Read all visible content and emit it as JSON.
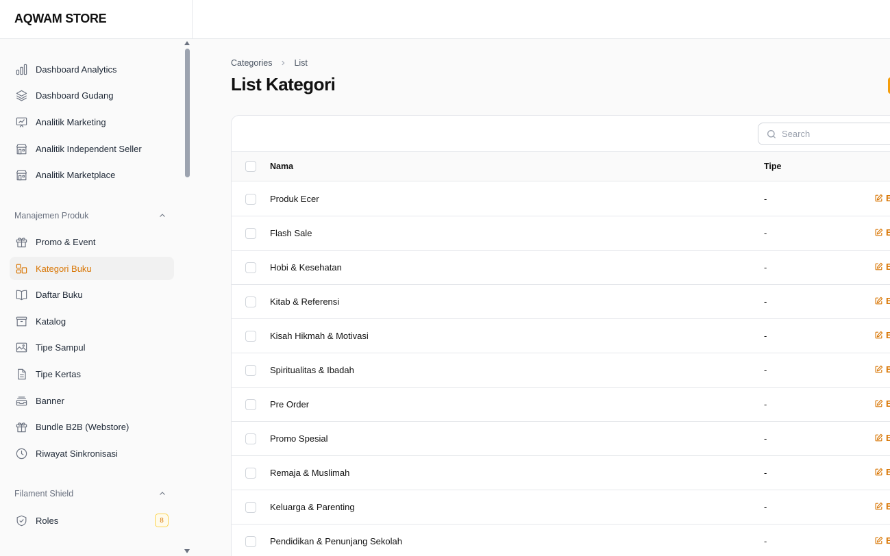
{
  "app": {
    "brand": "AQWAM STORE"
  },
  "colors": {
    "accent": "#d97706",
    "text": "#111827",
    "muted": "#6b7280",
    "border": "#e5e7eb"
  },
  "sidebar": {
    "analytics": [
      {
        "label": "Dashboard Analytics",
        "icon": "bar-chart-icon"
      },
      {
        "label": "Dashboard Gudang",
        "icon": "layers-icon"
      },
      {
        "label": "Analitik Marketing",
        "icon": "presentation-chart-icon"
      },
      {
        "label": "Analitik Independent Seller",
        "icon": "storefront-icon"
      },
      {
        "label": "Analitik Marketplace",
        "icon": "storefront-icon"
      }
    ],
    "groups": [
      {
        "label": "Manajemen Produk",
        "items": [
          {
            "label": "Promo & Event",
            "icon": "gift-icon"
          },
          {
            "label": "Kategori Buku",
            "icon": "grid-icon",
            "active": true
          },
          {
            "label": "Daftar Buku",
            "icon": "book-open-icon"
          },
          {
            "label": "Katalog",
            "icon": "archive-box-icon"
          },
          {
            "label": "Tipe Sampul",
            "icon": "photo-icon"
          },
          {
            "label": "Tipe Kertas",
            "icon": "document-icon"
          },
          {
            "label": "Banner",
            "icon": "inbox-stack-icon"
          },
          {
            "label": "Bundle B2B (Webstore)",
            "icon": "gift-icon"
          },
          {
            "label": "Riwayat Sinkronisasi",
            "icon": "clock-icon"
          }
        ]
      },
      {
        "label": "Filament Shield",
        "items": [
          {
            "label": "Roles",
            "icon": "shield-check-icon",
            "badge": "8"
          }
        ]
      }
    ]
  },
  "main": {
    "breadcrumb": [
      "Categories",
      "List"
    ],
    "title": "List Kategori",
    "search": {
      "placeholder": "Search",
      "value": ""
    },
    "table": {
      "columns": {
        "name": "Nama",
        "type": "Tipe"
      },
      "edit_label": "E",
      "rows": [
        {
          "name": "Produk Ecer",
          "type": "-"
        },
        {
          "name": "Flash Sale",
          "type": "-"
        },
        {
          "name": "Hobi & Kesehatan",
          "type": "-"
        },
        {
          "name": "Kitab & Referensi",
          "type": "-"
        },
        {
          "name": "Kisah Hikmah & Motivasi",
          "type": "-"
        },
        {
          "name": "Spiritualitas & Ibadah",
          "type": "-"
        },
        {
          "name": "Pre Order",
          "type": "-"
        },
        {
          "name": "Promo Spesial",
          "type": "-"
        },
        {
          "name": "Remaja & Muslimah",
          "type": "-"
        },
        {
          "name": "Keluarga & Parenting",
          "type": "-"
        },
        {
          "name": "Pendidikan & Penunjang Sekolah",
          "type": "-"
        }
      ]
    }
  }
}
